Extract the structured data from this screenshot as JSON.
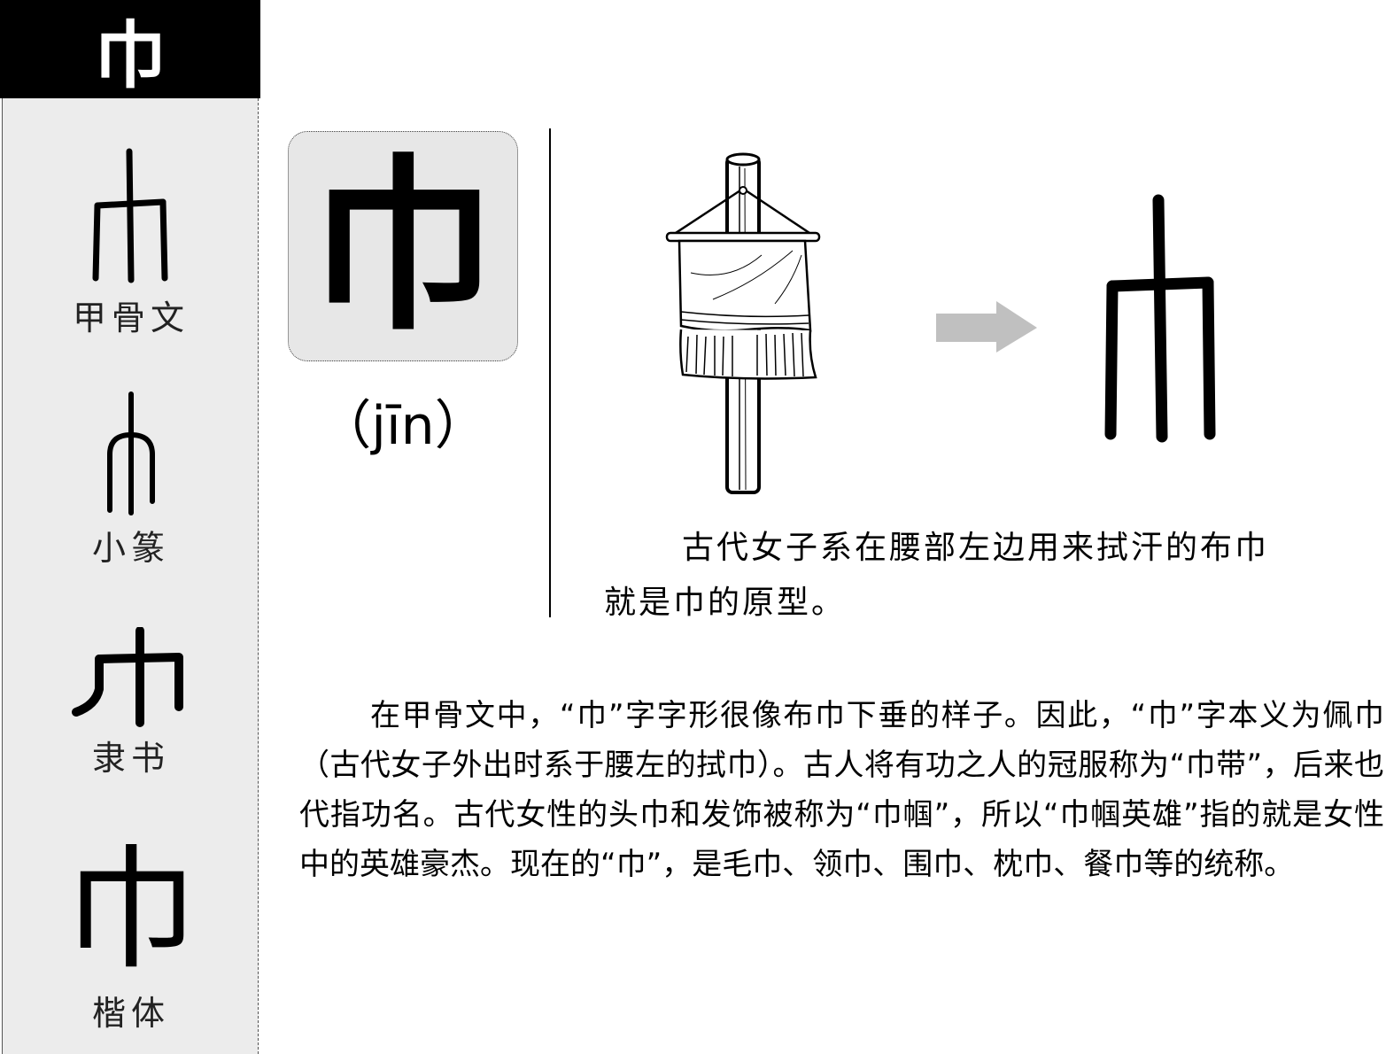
{
  "header": {
    "character": "巾"
  },
  "sidebar": {
    "scripts": [
      {
        "label": "甲骨文",
        "icon": "oracle-bone-glyph"
      },
      {
        "label": "小篆",
        "icon": "small-seal-glyph"
      },
      {
        "label": "隶书",
        "icon": "clerical-glyph"
      },
      {
        "label": "楷体",
        "glyph": "巾"
      }
    ]
  },
  "main": {
    "character": "巾",
    "pinyin": "（jīn）",
    "illustration": {
      "icon": "cloth-on-pole-illustration"
    },
    "arrow": {
      "icon": "right-arrow-icon",
      "color": "#c0c0c0"
    },
    "oracle_glyph": {
      "icon": "oracle-bone-glyph"
    },
    "caption_line1": "古代女子系在腰部左边用来拭汗的布巾",
    "caption_line2": "就是巾的原型。",
    "description": "在甲骨文中，“巾”字字形很像布巾下垂的样子。因此，“巾”字本义为佩巾（古代女子外出时系于腰左的拭巾）。古人将有功之人的冠服称为“巾带”，后来也代指功名。古代女性的头巾和发饰被称为“巾帼”，所以“巾帼英雄”指的就是女性中的英雄豪杰。现在的“巾”，是毛巾、领巾、围巾、枕巾、餐巾等的统称。"
  }
}
